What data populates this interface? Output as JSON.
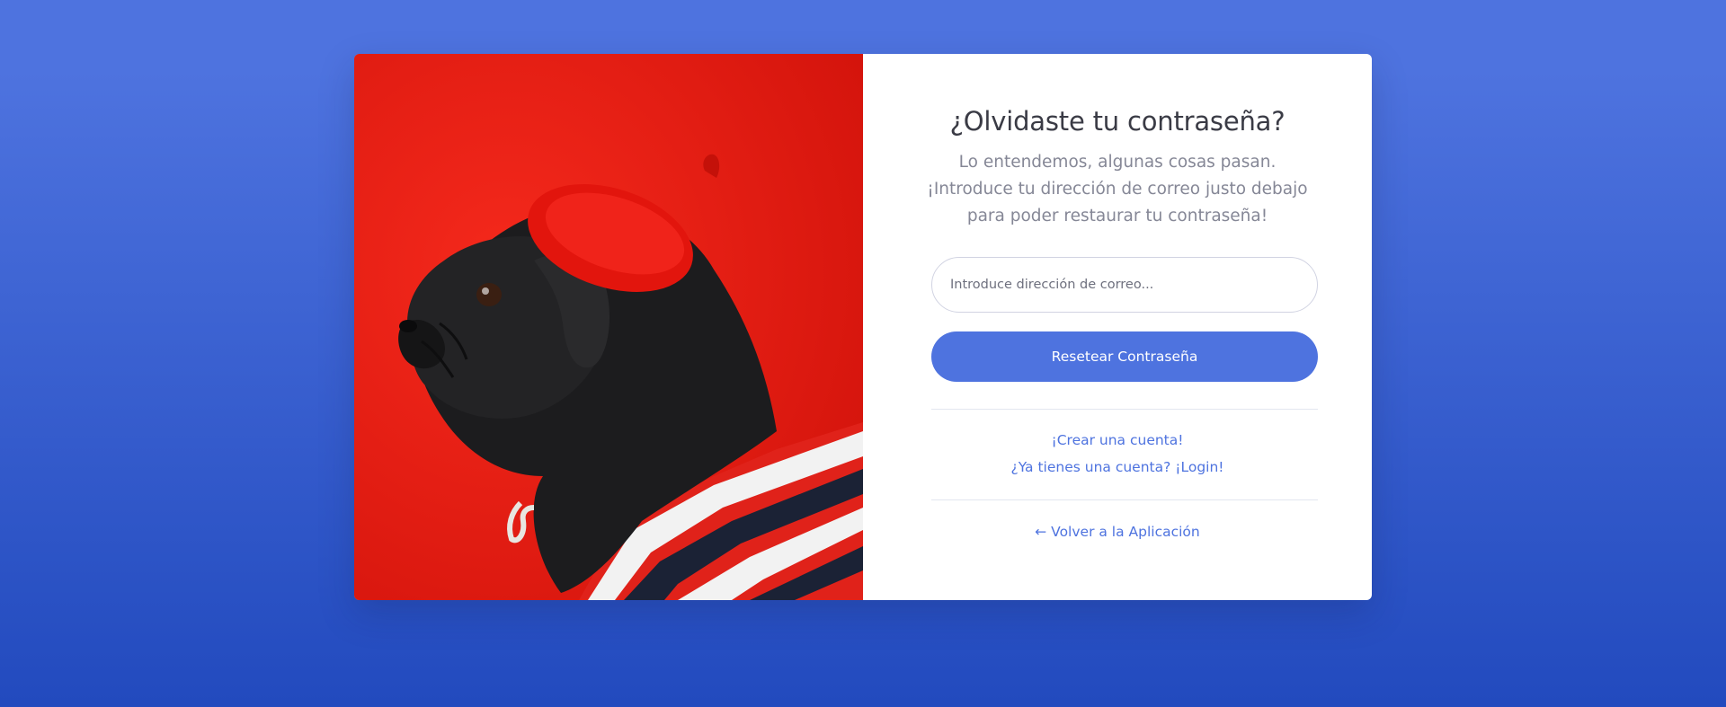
{
  "title": "¿Olvidaste tu contraseña?",
  "subtitle": "Lo entendemos, algunas cosas pasan. ¡Introduce tu dirección de correo justo debajo para poder restaurar tu contraseña!",
  "email": {
    "placeholder": "Introduce dirección de correo...",
    "value": ""
  },
  "reset_button_label": "Resetear Contraseña",
  "links": {
    "create_account": "¡Crear una cuenta!",
    "login": "¿Ya tienes una cuenta? ¡Login!",
    "back_to_app": "← Volver a la Aplicación"
  },
  "image": {
    "subject": "pug-wearing-red-beret-and-striped-shirt"
  },
  "colors": {
    "primary": "#4e73df",
    "background_top": "#4e73df",
    "background_bottom": "#224abe",
    "title_text": "#3a3b45",
    "muted_text": "#858796",
    "image_background": "#ea1d14"
  }
}
